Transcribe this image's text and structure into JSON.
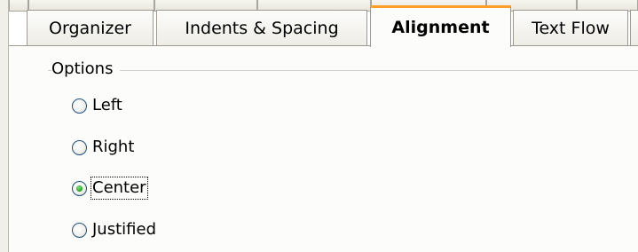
{
  "tabs": [
    {
      "label": "Organizer",
      "active": false
    },
    {
      "label": "Indents & Spacing",
      "active": false
    },
    {
      "label": "Alignment",
      "active": true
    },
    {
      "label": "Text Flow",
      "active": false
    }
  ],
  "options_group": {
    "label": "Options",
    "items": [
      {
        "label": "Left",
        "checked": false
      },
      {
        "label": "Right",
        "checked": false
      },
      {
        "label": "Center",
        "checked": true
      },
      {
        "label": "Justified",
        "checked": false
      }
    ]
  },
  "colors": {
    "active_tab_accent": "#ff9f2a",
    "radio_checked": "#21a121",
    "radio_border": "#1c5180"
  }
}
